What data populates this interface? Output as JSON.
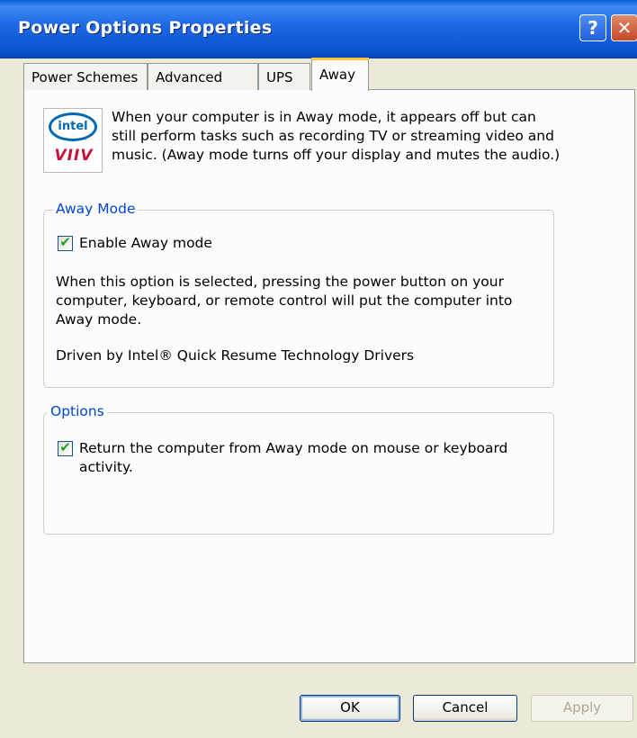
{
  "window": {
    "title": "Power Options Properties"
  },
  "title_buttons": {
    "help_glyph": "?",
    "close_glyph": "✕"
  },
  "tabs": [
    "Power Schemes",
    "Advanced",
    "UPS",
    "Away"
  ],
  "active_tab": "Away",
  "intro": {
    "logo_top": "intel",
    "logo_bottom": "VIIV",
    "text": "When your computer is in Away mode, it appears off but can still perform tasks such as recording TV or streaming video and music. (Away mode turns off your display and mutes the audio.)"
  },
  "away_mode": {
    "legend": "Away Mode",
    "enable_label": "Enable Away mode",
    "enable_checked": true,
    "description": "When this option is selected, pressing the power button on your computer, keyboard, or remote control will put the computer into Away mode.",
    "driven_by": "Driven by Intel® Quick Resume Technology Drivers"
  },
  "options": {
    "legend": "Options",
    "return_label": "Return the computer from Away mode on mouse or keyboard activity.",
    "return_checked": true
  },
  "buttons": {
    "ok": "OK",
    "cancel": "Cancel",
    "apply": "Apply"
  },
  "colors": {
    "titlebar": "#0a55d2",
    "group_legend": "#0046d5",
    "tab_highlight": "#ffc83c",
    "check": "#21a121"
  },
  "icons": {
    "help": "help-icon",
    "close": "close-icon",
    "check": "checkmark-icon"
  }
}
